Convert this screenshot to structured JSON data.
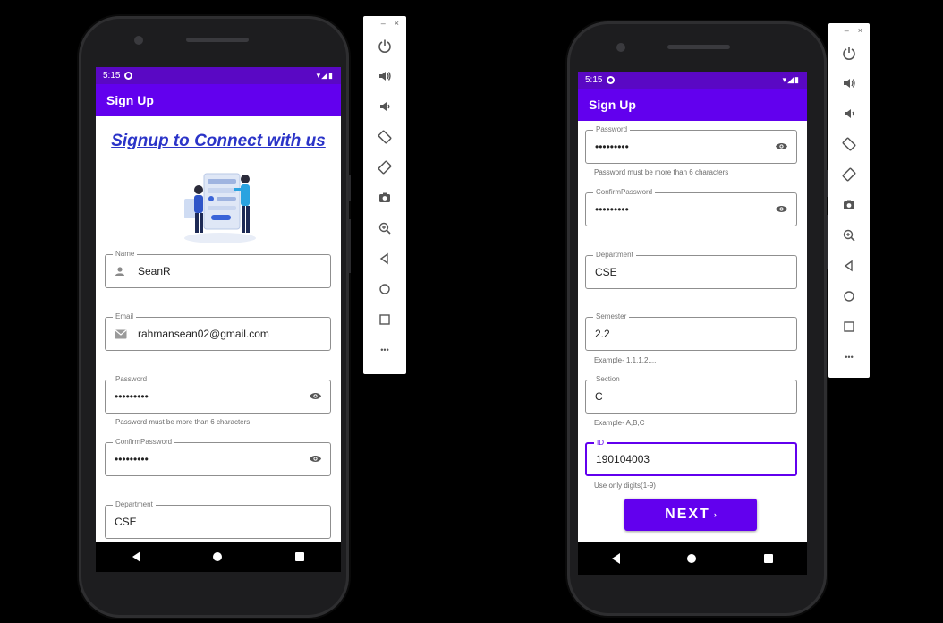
{
  "status_bar": {
    "time": "5:15",
    "signal": "▾◢▮"
  },
  "left_screen": {
    "appbar_title": "Sign Up",
    "heading": "Signup to Connect with us",
    "fields": {
      "name": {
        "label": "Name",
        "value": "SeanR"
      },
      "email": {
        "label": "Email",
        "value": "rahmansean02@gmail.com"
      },
      "password": {
        "label": "Password",
        "value": "•••••••••",
        "helper": "Password must be more than 6 characters"
      },
      "confirm_password": {
        "label": "ConfirmPassword",
        "value": "•••••••••"
      },
      "department": {
        "label": "Department",
        "value": "CSE"
      }
    }
  },
  "right_screen": {
    "appbar_title": "Sign Up",
    "fields": {
      "password": {
        "label": "Password",
        "value": "•••••••••",
        "helper": "Password must be more than 6 characters"
      },
      "confirm_password": {
        "label": "ConfirmPassword",
        "value": "•••••••••"
      },
      "department": {
        "label": "Department",
        "value": "CSE"
      },
      "semester": {
        "label": "Semester",
        "value": "2.2",
        "helper": "Example- 1.1,1.2,..."
      },
      "section": {
        "label": "Section",
        "value": "C",
        "helper": "Example- A,B,C"
      },
      "id": {
        "label": "ID",
        "value": "190104003",
        "helper": "Use only digits(1-9)"
      }
    },
    "next_button": {
      "label": "NEXT",
      "chevron": "›"
    }
  },
  "emulator_toolbar": {
    "minimize": "–",
    "close": "×",
    "more": "•••"
  },
  "colors": {
    "status_bar": "#5a08c4",
    "app_bar": "#6200ee",
    "heading": "#2b34c8",
    "focus": "#6200ee"
  },
  "icons": [
    "power-icon",
    "volume-up-icon",
    "volume-down-icon",
    "rotate-left-icon",
    "rotate-right-icon",
    "camera-icon",
    "zoom-in-icon",
    "back-icon",
    "home-icon",
    "overview-icon",
    "more-icon",
    "person-icon",
    "mail-icon",
    "eye-icon"
  ]
}
